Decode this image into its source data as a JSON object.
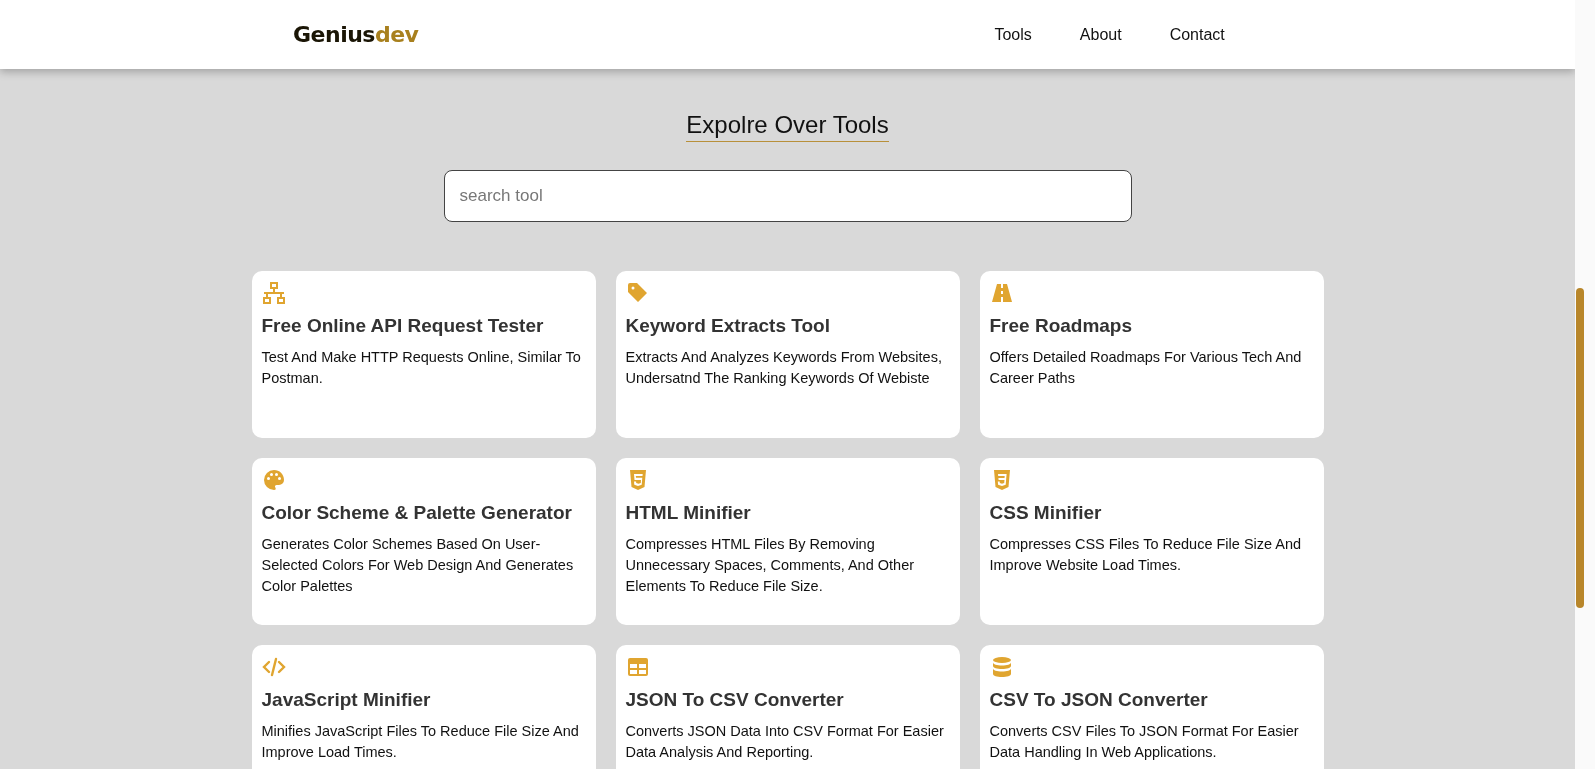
{
  "header": {
    "logo": {
      "first": "Genius",
      "second": "dev"
    },
    "nav": [
      "Tools",
      "About",
      "Contact"
    ]
  },
  "heading": "Expolre Over Tools",
  "search": {
    "placeholder": "search tool"
  },
  "tools": [
    {
      "kind": "network",
      "title": "Free Online API Request Tester",
      "description": "Test And Make HTTP Requests Online, Similar To Postman."
    },
    {
      "kind": "tag",
      "title": "Keyword Extracts Tool",
      "description": "Extracts And Analyzes Keywords From Websites, Undersatnd The Ranking Keywords Of Webiste"
    },
    {
      "kind": "road",
      "title": "Free Roadmaps",
      "description": "Offers Detailed Roadmaps For Various Tech And Career Paths"
    },
    {
      "kind": "palette",
      "title": "Color Scheme & Palette Generator",
      "description": "Generates Color Schemes Based On User-Selected Colors For Web Design And Generates Color Palettes"
    },
    {
      "kind": "html",
      "title": "HTML Minifier",
      "description": "Compresses HTML Files By Removing Unnecessary Spaces, Comments, And Other Elements To Reduce File Size."
    },
    {
      "kind": "css",
      "title": "CSS Minifier",
      "description": "Compresses CSS Files To Reduce File Size And Improve Website Load Times."
    },
    {
      "kind": "code",
      "title": "JavaScript Minifier",
      "description": "Minifies JavaScript Files To Reduce File Size And Improve Load Times."
    },
    {
      "kind": "table",
      "title": "JSON To CSV Converter",
      "description": "Converts JSON Data Into CSV Format For Easier Data Analysis And Reporting."
    },
    {
      "kind": "database",
      "title": "CSV To JSON Converter",
      "description": "Converts CSV Files To JSON Format For Easier Data Handling In Web Applications."
    }
  ]
}
